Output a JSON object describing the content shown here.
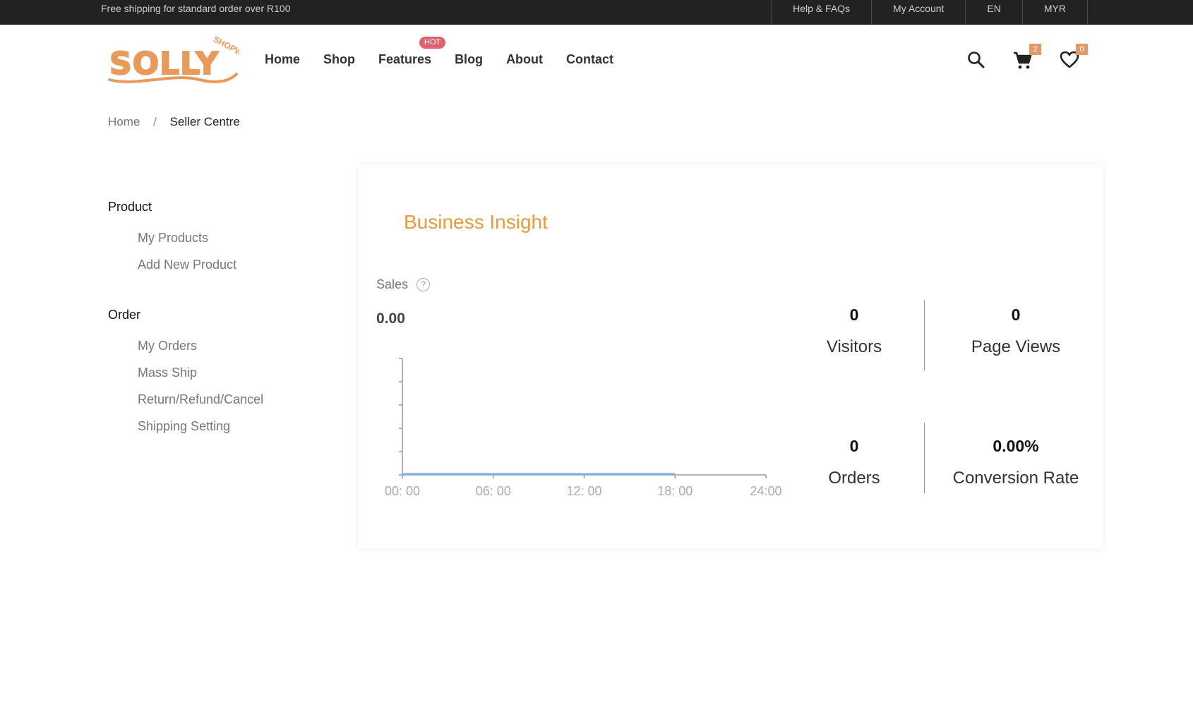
{
  "topbar": {
    "promo": "Free shipping for standard order over R100",
    "links": [
      "Help & FAQs",
      "My Account",
      "EN",
      "MYR"
    ]
  },
  "brand": {
    "logo_text": "SOLLY",
    "logo_sub": "SHOPWE",
    "logo_color": "#e89a5a"
  },
  "nav": {
    "items": [
      "Home",
      "Shop",
      "Features",
      "Blog",
      "About",
      "Contact"
    ],
    "hot_badge": "HOT"
  },
  "header_icons": {
    "search": "search-icon",
    "cart": "cart-icon",
    "cart_count": "2",
    "wishlist": "heart-icon",
    "wishlist_count": "0"
  },
  "breadcrumb": {
    "home": "Home",
    "separator": "/",
    "current": "Seller Centre"
  },
  "sidebar": {
    "product": {
      "heading": "Product",
      "links": [
        "My Products",
        "Add New Product"
      ]
    },
    "order": {
      "heading": "Order",
      "links": [
        "My Orders",
        "Mass Ship",
        "Return/Refund/Cancel",
        "Shipping Setting"
      ]
    }
  },
  "insight": {
    "title": "Business Insight",
    "sales_label": "Sales",
    "help_icon": "?",
    "sales_value": "0.00",
    "stats": {
      "visitors": {
        "value": "0",
        "label": "Visitors"
      },
      "page_views": {
        "value": "0",
        "label": "Page Views"
      },
      "orders": {
        "value": "0",
        "label": "Orders"
      },
      "conversion": {
        "value": "0.00%",
        "label": "Conversion Rate"
      }
    }
  },
  "chart_data": {
    "type": "line",
    "x": [
      "00: 00",
      "06: 00",
      "12: 00",
      "18: 00",
      "24:00"
    ],
    "series": [
      {
        "values": [
          0,
          0,
          0,
          0
        ]
      }
    ],
    "color": "#7fa8f0"
  }
}
